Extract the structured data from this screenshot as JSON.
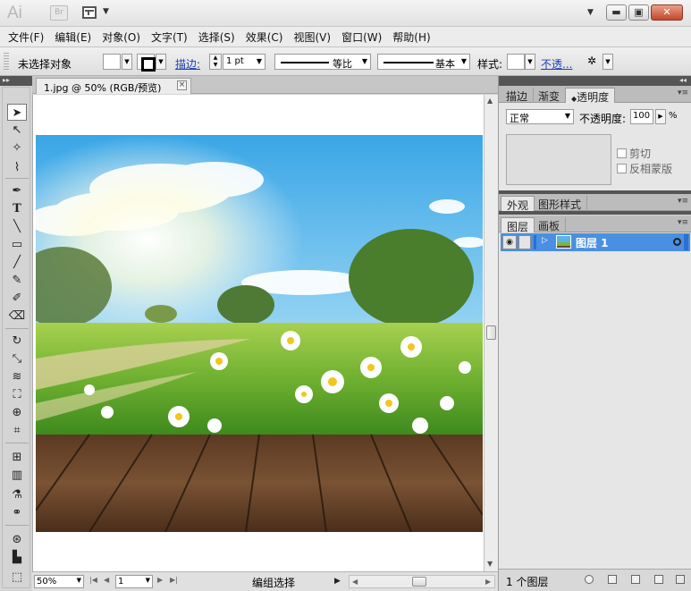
{
  "app": {
    "logo_text": "Ai",
    "bridge_label": "Br"
  },
  "menu": [
    "文件(F)",
    "编辑(E)",
    "对象(O)",
    "文字(T)",
    "选择(S)",
    "效果(C)",
    "视图(V)",
    "窗口(W)",
    "帮助(H)"
  ],
  "control_bar": {
    "selection_status": "未选择对象",
    "stroke_link": "描边:",
    "stroke_weight": "1 pt",
    "variable_width_profile": "等比",
    "brush_definition": "基本",
    "style_label": "样式:",
    "opacity_link": "不透..."
  },
  "document": {
    "tab_title": "1.jpg @ 50% (RGB/预览)",
    "tab_close": "×"
  },
  "statusbar": {
    "zoom": "50%",
    "artboard_number": "1",
    "status_text": "编组选择"
  },
  "panels": {
    "top_tabs": [
      "描边",
      "渐变",
      "透明度"
    ],
    "active_top_tab": 2,
    "blend_mode": "正常",
    "opacity_label": "不透明度:",
    "opacity_value": "100",
    "opacity_unit": "%",
    "clip_label": "剪切",
    "invert_mask_label": "反相蒙版",
    "appearance_tabs": [
      "外观",
      "图形样式"
    ],
    "layer_tabs": [
      "图层",
      "画板"
    ],
    "layers": [
      {
        "name": "图层 1",
        "color": "#2a6fd6"
      }
    ],
    "layer_count": "1 个图层"
  },
  "colors": {
    "selection_blue": "#4a90e2",
    "layer_blue": "#2a6fd6",
    "link_blue": "#1a3fbf"
  }
}
